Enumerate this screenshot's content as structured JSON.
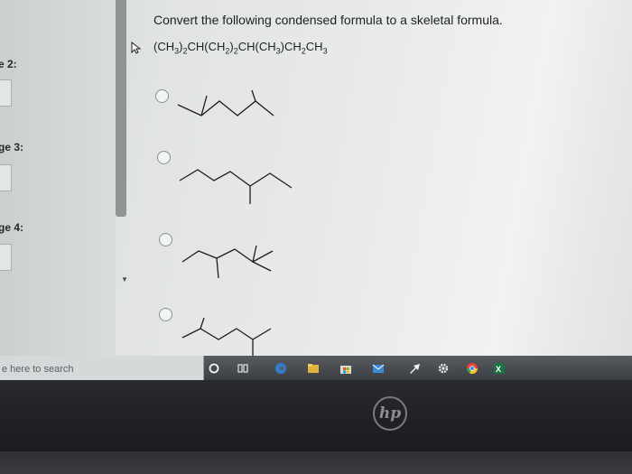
{
  "sidebar": {
    "labels": [
      "e 2:",
      "ge 3:",
      "ge 4:"
    ]
  },
  "question": {
    "prompt": "Convert the following condensed formula to a skeletal formula.",
    "formula_parts": [
      "(CH",
      "3",
      ")",
      "2",
      "CH(CH",
      "2",
      ")",
      "2",
      "CH(CH",
      "3",
      ")CH",
      "2",
      "CH",
      "3"
    ]
  },
  "options": [
    "option-a",
    "option-b",
    "option-c",
    "option-d"
  ],
  "taskbar": {
    "search_placeholder": "e here to search",
    "icons": [
      "cortana-circle-icon",
      "task-view-icon",
      "edge-icon",
      "file-explorer-icon",
      "store-icon",
      "mail-icon",
      "arrow-app-icon",
      "settings-gear-icon",
      "chrome-icon",
      "excel-icon"
    ]
  },
  "device": {
    "logo_text": "hp"
  }
}
